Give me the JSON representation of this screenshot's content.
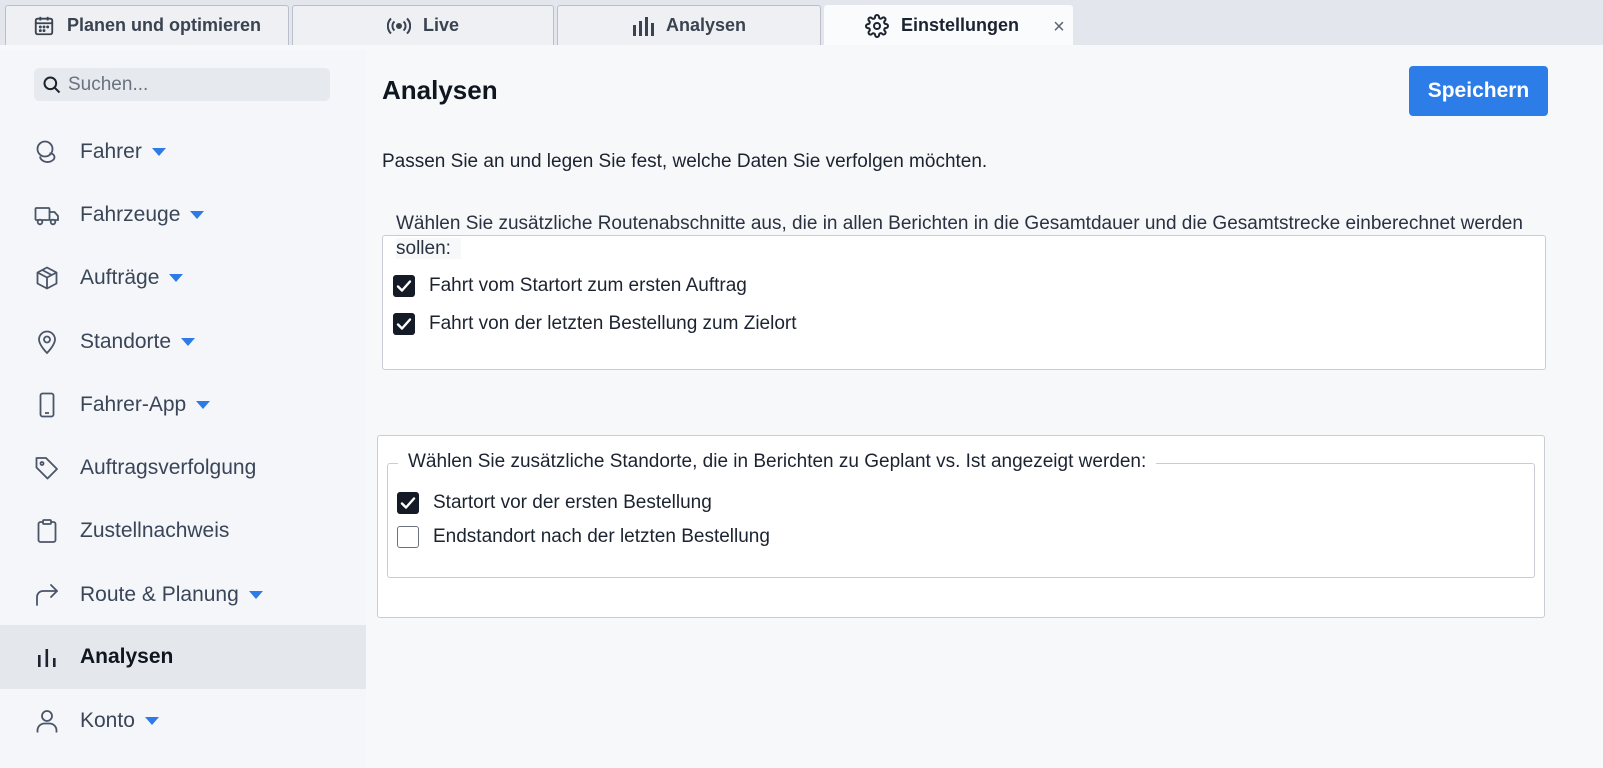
{
  "tabs": [
    {
      "label": "Planen und optimieren",
      "icon": "calendar-icon"
    },
    {
      "label": "Live",
      "icon": "broadcast-icon"
    },
    {
      "label": "Analysen",
      "icon": "bar-chart-icon"
    },
    {
      "label": "Einstellungen",
      "icon": "gear-icon",
      "active": true
    }
  ],
  "tab_close_label": "×",
  "search": {
    "placeholder": "Suchen..."
  },
  "sidebar": {
    "items": [
      {
        "label": "Fahrer",
        "icon": "driver-icon",
        "has_caret": true
      },
      {
        "label": "Fahrzeuge",
        "icon": "truck-icon",
        "has_caret": true
      },
      {
        "label": "Aufträge",
        "icon": "box-icon",
        "has_caret": true
      },
      {
        "label": "Standorte",
        "icon": "location-pin-icon",
        "has_caret": true
      },
      {
        "label": "Fahrer-App",
        "icon": "phone-icon",
        "has_caret": true
      },
      {
        "label": "Auftragsverfolgung",
        "icon": "tag-icon",
        "has_caret": false
      },
      {
        "label": "Zustellnachweis",
        "icon": "clipboard-icon",
        "has_caret": false
      },
      {
        "label": "Route & Planung",
        "icon": "route-arrow-icon",
        "has_caret": true
      },
      {
        "label": "Analysen",
        "icon": "bar-chart-icon",
        "has_caret": false,
        "active": true
      },
      {
        "label": "Konto",
        "icon": "user-icon",
        "has_caret": true
      }
    ]
  },
  "main": {
    "title": "Analysen",
    "save_label": "Speichern",
    "intro": "Passen Sie an und legen Sie fest, welche Daten Sie verfolgen möchten.",
    "group1": {
      "legend": "Wählen Sie zusätzliche Routenabschnitte aus, die in allen Berichten in die Gesamtdauer und die Gesamtstrecke einberechnet werden sollen:",
      "options": [
        {
          "label": "Fahrt vom Startort zum ersten Auftrag",
          "checked": true
        },
        {
          "label": "Fahrt von der letzten Bestellung zum Zielort",
          "checked": true
        }
      ]
    },
    "group2": {
      "legend": "Wählen Sie zusätzliche Standorte, die in Berichten zu Geplant vs. Ist angezeigt werden:",
      "options": [
        {
          "label": "Startort vor der ersten Bestellung",
          "checked": true
        },
        {
          "label": "Endstandort nach der letzten Bestellung",
          "checked": false
        }
      ]
    }
  },
  "colors": {
    "accent": "#2d7de9",
    "checkbox_checked": "#141a26",
    "sidebar_active_bg": "#e4e7ec"
  }
}
